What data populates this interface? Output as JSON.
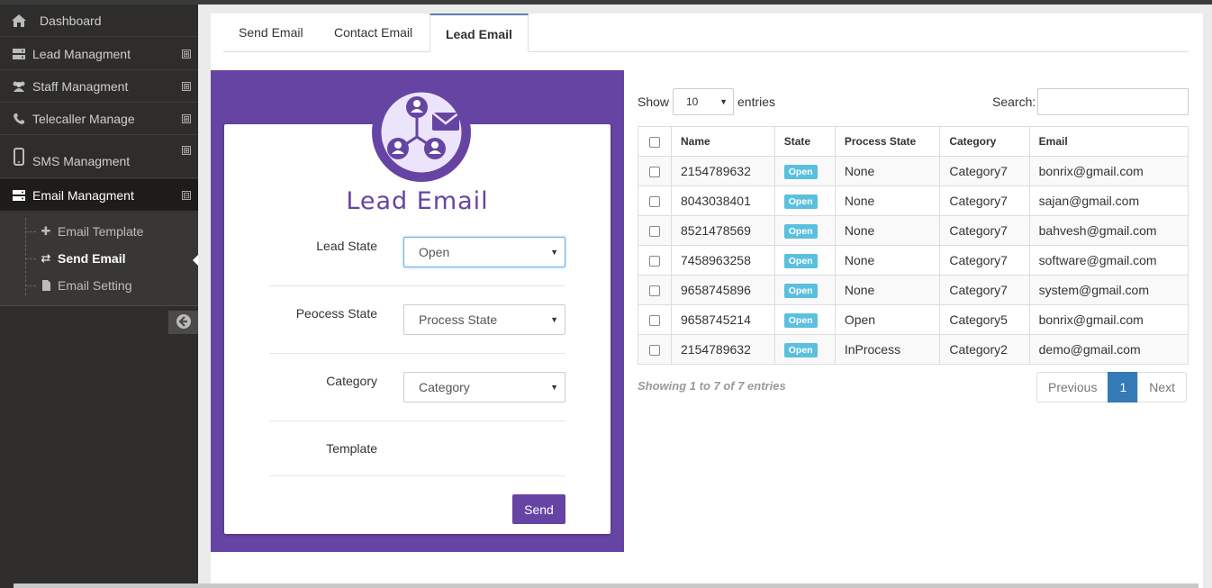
{
  "sidebar": {
    "items": [
      {
        "label": "Dashboard",
        "icon": "home-icon"
      },
      {
        "label": "Lead Managment",
        "icon": "server-icon",
        "toggle": "⊞"
      },
      {
        "label": "Staff Managment",
        "icon": "users-icon",
        "toggle": "⊞"
      },
      {
        "label": "Telecaller Manage",
        "icon": "phone-icon",
        "toggle": "⊞"
      },
      {
        "label": "SMS Managment",
        "icon": "mobile-icon",
        "toggle": "⊞"
      },
      {
        "label": "Email Managment",
        "icon": "server-icon",
        "toggle": "⊟"
      }
    ],
    "subitems": [
      {
        "label": "Email Template",
        "icon": "plus-icon"
      },
      {
        "label": "Send Email",
        "icon": "exchange-icon"
      },
      {
        "label": "Email Setting",
        "icon": "file-icon"
      }
    ]
  },
  "tabs": [
    "Send Email",
    "Contact Email",
    "Lead Email"
  ],
  "form": {
    "title": "Lead Email",
    "lead_state_label": "Lead State",
    "lead_state_value": "Open",
    "process_state_label": "Peocess State",
    "process_state_value": "Process State",
    "category_label": "Category",
    "category_value": "Category",
    "template_label": "Template",
    "send_label": "Send"
  },
  "datatable": {
    "show_label": "Show",
    "page_length": "10",
    "entries_label": "entries",
    "search_label": "Search:",
    "search_value": "",
    "columns": [
      "Name",
      "State",
      "Process State",
      "Category",
      "Email"
    ],
    "rows": [
      {
        "name": "2154789632",
        "state": "Open",
        "process": "None",
        "category": "Category7",
        "email": "bonrix@gmail.com"
      },
      {
        "name": "8043038401",
        "state": "Open",
        "process": "None",
        "category": "Category7",
        "email": "sajan@gmail.com"
      },
      {
        "name": "8521478569",
        "state": "Open",
        "process": "None",
        "category": "Category7",
        "email": "bahvesh@gmail.com"
      },
      {
        "name": "7458963258",
        "state": "Open",
        "process": "None",
        "category": "Category7",
        "email": "software@gmail.com"
      },
      {
        "name": "9658745896",
        "state": "Open",
        "process": "None",
        "category": "Category7",
        "email": "system@gmail.com"
      },
      {
        "name": "9658745214",
        "state": "Open",
        "process": "Open",
        "category": "Category5",
        "email": "bonrix@gmail.com"
      },
      {
        "name": "2154789632",
        "state": "Open",
        "process": "InProcess",
        "category": "Category2",
        "email": "demo@gmail.com"
      }
    ],
    "info": "Showing 1 to 7 of 7 entries",
    "prev_label": "Previous",
    "current_page": "1",
    "next_label": "Next"
  },
  "colors": {
    "accent": "#6644a3",
    "sidebar": "#2e2d2b",
    "badge": "#5bc0de",
    "page_active": "#337ab7"
  }
}
